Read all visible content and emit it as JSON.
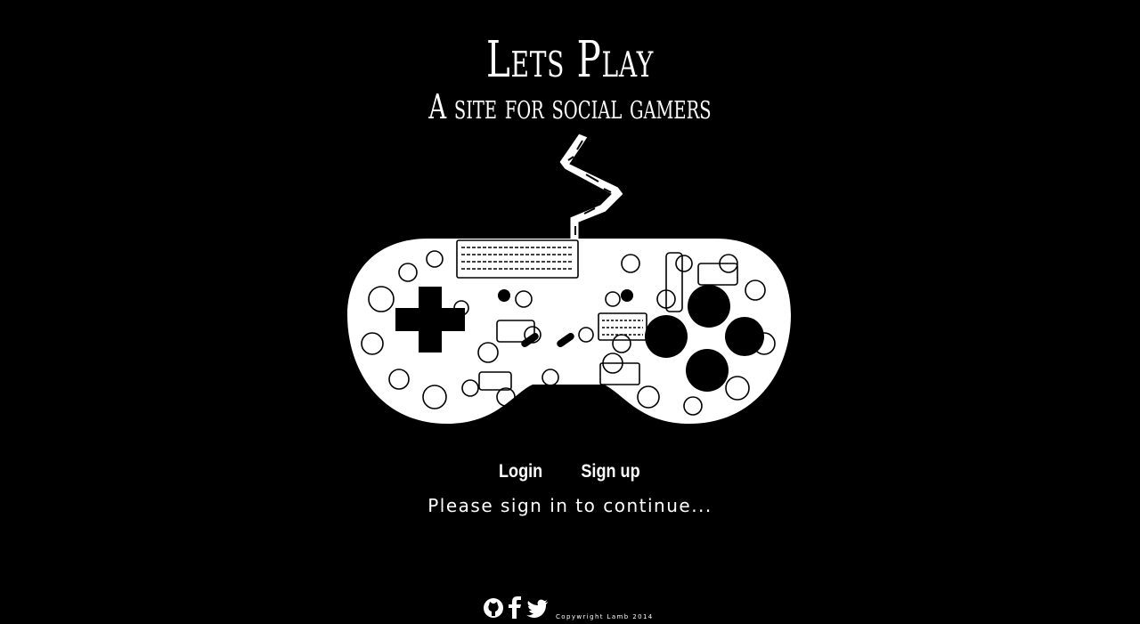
{
  "header": {
    "title": "Lets Play",
    "subtitle": "A site for social gamers"
  },
  "nav": {
    "login_label": "Login",
    "signup_label": "Sign up"
  },
  "message": "Please sign in to continue...",
  "footer": {
    "icons": [
      "github-icon",
      "facebook-icon",
      "twitter-icon"
    ],
    "copyright": "Copywright Lamb 2014"
  },
  "colors": {
    "background": "#000000",
    "foreground": "#ffffff"
  }
}
